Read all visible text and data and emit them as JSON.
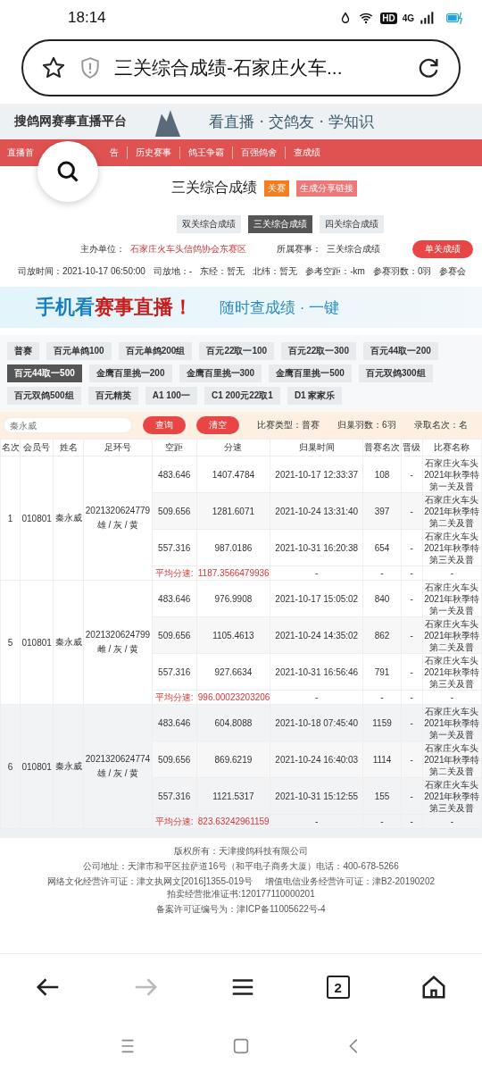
{
  "status_bar": {
    "time": "18:14",
    "hd": "HD",
    "network": "4G"
  },
  "address_bar": {
    "title": "三关综合成绩-石家庄火车..."
  },
  "banner": {
    "site_title": "搜鸽网赛事直播平台",
    "slogan": "看直播 · 交鸽友 · 学知识"
  },
  "nav": [
    "直播首",
    "告",
    "历史赛事",
    "鸽王争霸",
    "百强鸽舍",
    "查成绩"
  ],
  "page": {
    "title": "三关综合成绩",
    "badge": "关赛",
    "share_button": "生成分享链接",
    "tabs": [
      {
        "label": "双关综合成绩",
        "selected": false
      },
      {
        "label": "三关综合成绩",
        "selected": true
      },
      {
        "label": "四关综合成绩",
        "selected": false
      }
    ],
    "organizer_label": "主办单位：",
    "organizer": "石家庄火车头信鸽协会东赛区",
    "event_label": "所属赛事：",
    "event": "三关综合成绩",
    "single_button": "单关成绩",
    "facts": [
      "司放时间：2021-10-17 06:50:00",
      "司放地：-",
      "东经：暂无",
      "北纬：暂无",
      "参考空距：-km",
      "参赛羽数：0羽",
      "参赛会"
    ]
  },
  "ad_banner": {
    "headline_1": "手机看",
    "headline_2": "赛事直播！",
    "tagline": "随时查成绩 · 一键"
  },
  "categories": [
    {
      "label": "普赛",
      "selected": false
    },
    {
      "label": "百元单鸽100",
      "selected": false
    },
    {
      "label": "百元单鸽200组",
      "selected": false
    },
    {
      "label": "百元22取一100",
      "selected": false
    },
    {
      "label": "百元22取一300",
      "selected": false
    },
    {
      "label": "百元44取一200",
      "selected": false
    },
    {
      "label": "百元44取一500",
      "selected": true
    },
    {
      "label": "金鹰百里挑一200",
      "selected": false
    },
    {
      "label": "金鹰百里挑一300",
      "selected": false
    },
    {
      "label": "金鹰百里挑一500",
      "selected": false
    },
    {
      "label": "百元双鸽300组",
      "selected": false
    },
    {
      "label": "百元双鸽500组",
      "selected": false
    },
    {
      "label": "百元精英",
      "selected": false
    },
    {
      "label": "A1 100一",
      "selected": false
    },
    {
      "label": "C1 200元22取1",
      "selected": false
    },
    {
      "label": "D1 家家乐",
      "selected": false
    }
  ],
  "search": {
    "placeholder": "秦永威",
    "query_button": "查询",
    "clear_button": "清空",
    "stats": [
      "比赛类型：普赛",
      "归巢羽数：6羽",
      "录取名次：名"
    ]
  },
  "table": {
    "columns": [
      "名次",
      "会员号",
      "姓名",
      "足环号",
      "空距",
      "分速",
      "归巢时间",
      "普赛名次",
      "晋级",
      "比赛名称"
    ],
    "groups": [
      {
        "rank": "1",
        "member": "010801",
        "name": "秦永威",
        "ring": "2021320624779",
        "ring_info": "雄 / 灰 / 黄",
        "highlighted": false,
        "legs": [
          {
            "distance": "483.646",
            "speed": "1407.4784",
            "time": "2021-10-17 12:33:37",
            "place": "108",
            "promotion": "-",
            "race": [
              "石家庄火车头",
              "2021年秋季特",
              "第一关及普"
            ]
          },
          {
            "distance": "509.656",
            "speed": "1281.6071",
            "time": "2021-10-24 13:31:40",
            "place": "397",
            "promotion": "-",
            "race": [
              "石家庄火车头",
              "2021年秋季特",
              "第二关及普"
            ]
          },
          {
            "distance": "557.316",
            "speed": "987.0186",
            "time": "2021-10-31 16:20:38",
            "place": "654",
            "promotion": "-",
            "race": [
              "石家庄火车头",
              "2021年秋季特",
              "第三关及普"
            ]
          }
        ],
        "average": {
          "label": "平均分速:",
          "value": "1187.3566479936",
          "rest": [
            "-",
            "-",
            "-",
            "-"
          ]
        }
      },
      {
        "rank": "5",
        "member": "010801",
        "name": "秦永威",
        "ring": "2021320624799",
        "ring_info": "雌 / 灰 / 黄",
        "highlighted": false,
        "legs": [
          {
            "distance": "483.646",
            "speed": "976.9908",
            "time": "2021-10-17 15:05:02",
            "place": "840",
            "promotion": "-",
            "race": [
              "石家庄火车头",
              "2021年秋季特",
              "第一关及普"
            ]
          },
          {
            "distance": "509.656",
            "speed": "1105.4613",
            "time": "2021-10-24 14:35:02",
            "place": "862",
            "promotion": "-",
            "race": [
              "石家庄火车头",
              "2021年秋季特",
              "第二关及普"
            ]
          },
          {
            "distance": "557.316",
            "speed": "927.6634",
            "time": "2021-10-31 16:56:46",
            "place": "791",
            "promotion": "-",
            "race": [
              "石家庄火车头",
              "2021年秋季特",
              "第三关及普"
            ]
          }
        ],
        "average": {
          "label": "平均分速:",
          "value": "996.00023203206",
          "rest": [
            "-",
            "-",
            "-",
            "-"
          ]
        }
      },
      {
        "rank": "6",
        "member": "010801",
        "name": "秦永威",
        "ring": "2021320624774",
        "ring_info": "雄 / 灰 / 黄",
        "highlighted": true,
        "legs": [
          {
            "distance": "483.646",
            "speed": "604.8088",
            "time": "2021-10-18 07:45:40",
            "place": "1159",
            "promotion": "-",
            "race": [
              "石家庄火车头",
              "2021年秋季特",
              "第一关及普"
            ]
          },
          {
            "distance": "509.656",
            "speed": "869.6219",
            "time": "2021-10-24 16:40:03",
            "place": "1114",
            "promotion": "-",
            "race": [
              "石家庄火车头",
              "2021年秋季特",
              "第二关及普"
            ]
          },
          {
            "distance": "557.316",
            "speed": "1121.5317",
            "time": "2021-10-31 15:12:55",
            "place": "155",
            "promotion": "-",
            "race": [
              "石家庄火车头",
              "2021年秋季特",
              "第三关及普"
            ]
          }
        ],
        "average": {
          "label": "平均分速:",
          "value": "823.63242961159",
          "rest": [
            "-",
            "-",
            "-",
            "-"
          ]
        }
      }
    ]
  },
  "footer": {
    "lines": [
      [
        "版权所有：天津搜鸽科技有限公司"
      ],
      [
        "公司地址：天津市和平区拉萨道16号（和平电子商务大厦）电话：400-678-5266"
      ],
      [
        "网络文化经营许可证：津文执网文[2016]1355-019号",
        "增值电信业务经营许可证：津B2-20190202",
        "拍卖经营批准证书:120177110000201"
      ],
      [
        "备案许可证编号为：津ICP备11005622号-4"
      ]
    ]
  },
  "browser_bar": {
    "back_enabled": true,
    "forward_enabled": false,
    "tab_count": "2"
  }
}
